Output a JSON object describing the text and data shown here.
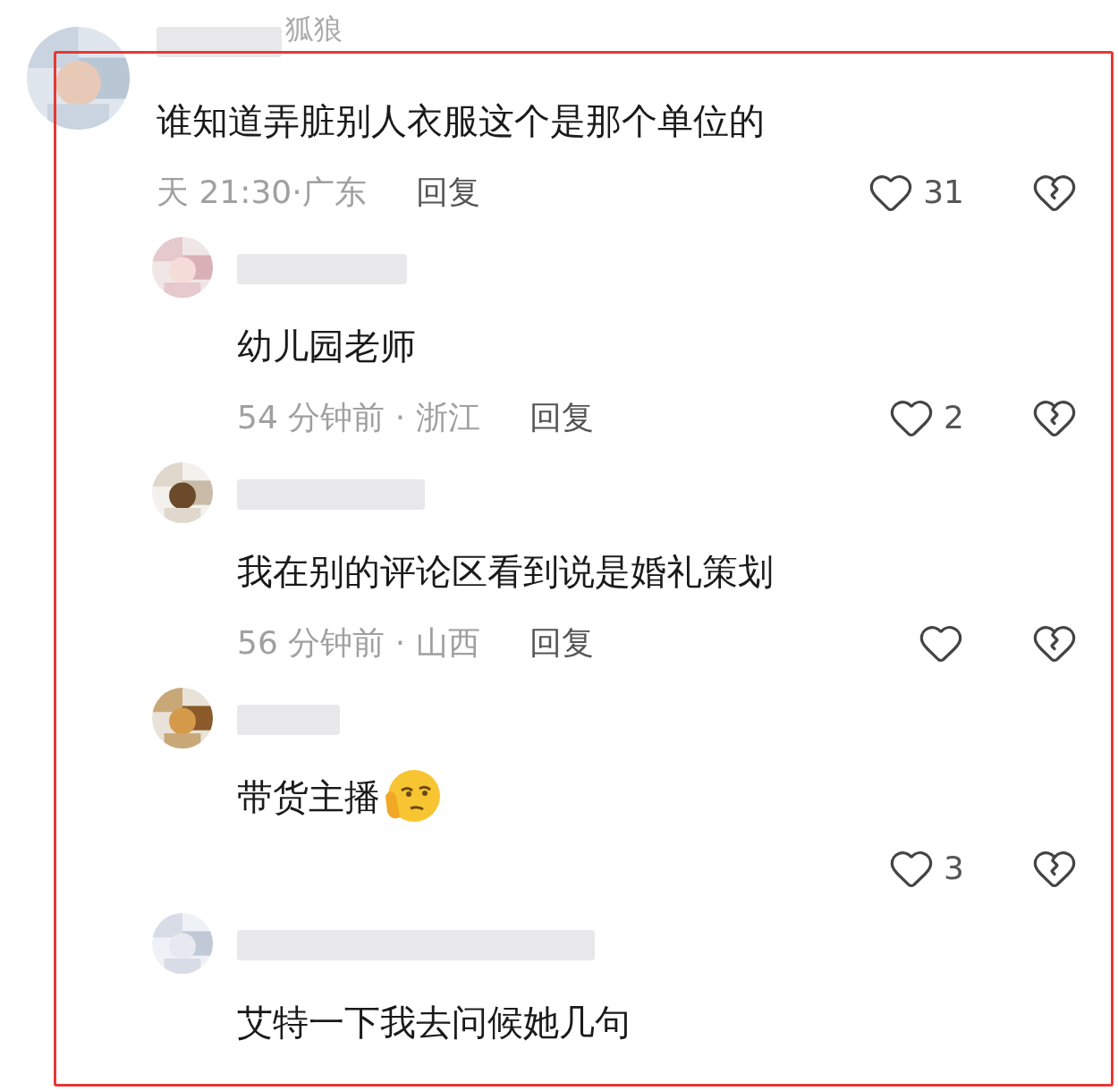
{
  "comments": [
    {
      "username": "狐狼",
      "text": "谁知道弄脏别人衣服这个是那个单位的",
      "meta": "天 21:30·广东",
      "reply": "回复",
      "likes": "31",
      "replies": [
        {
          "text": "幼儿园老师",
          "meta": "54 分钟前 · 浙江",
          "reply": "回复",
          "likes": "2"
        },
        {
          "text": "我在别的评论区看到说是婚礼策划",
          "meta": "56 分钟前 · 山西",
          "reply": "回复"
        },
        {
          "text": "带货主播",
          "emoji": true,
          "likes": "3"
        },
        {
          "text": "艾特一下我去问候她几句"
        }
      ]
    }
  ]
}
